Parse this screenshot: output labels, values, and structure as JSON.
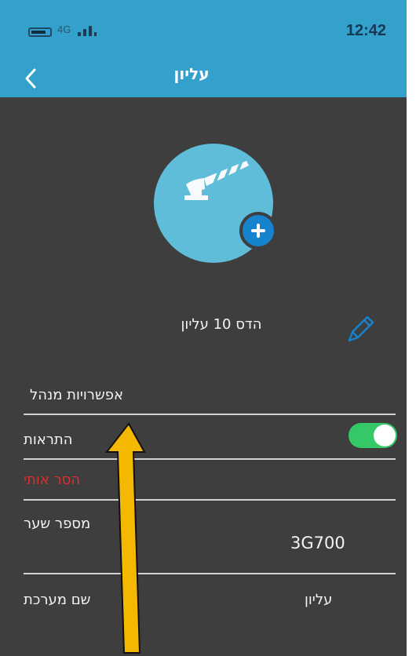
{
  "status_bar": {
    "network": "4G",
    "time": "12:42"
  },
  "header": {
    "title": "עליון",
    "back_icon": "chevron-left-icon"
  },
  "profile": {
    "image_icon": "barrier-gate-icon",
    "add_icon": "plus-icon",
    "gate_name": "הדס 10 עליון",
    "edit_icon": "pencil-icon"
  },
  "settings": {
    "admin_options": "אפשרויות מנהל",
    "alerts": "התראות",
    "alerts_enabled": true,
    "remove_me": "הסר אותי",
    "gate_number_label": "מספר שער",
    "gate_number_value": "3G700",
    "system_name_label": "שם מערכת",
    "system_name_value": "עליון"
  },
  "colors": {
    "header": "#34a0cc",
    "background": "#3e3e3e",
    "avatar": "#5fbdd9",
    "add_button": "#1683cf",
    "toggle_on": "#35c866",
    "destructive_text": "#d92f2f",
    "annotation_arrow": "#f5b800"
  },
  "annotation": {
    "icon": "arrow-up-icon"
  }
}
